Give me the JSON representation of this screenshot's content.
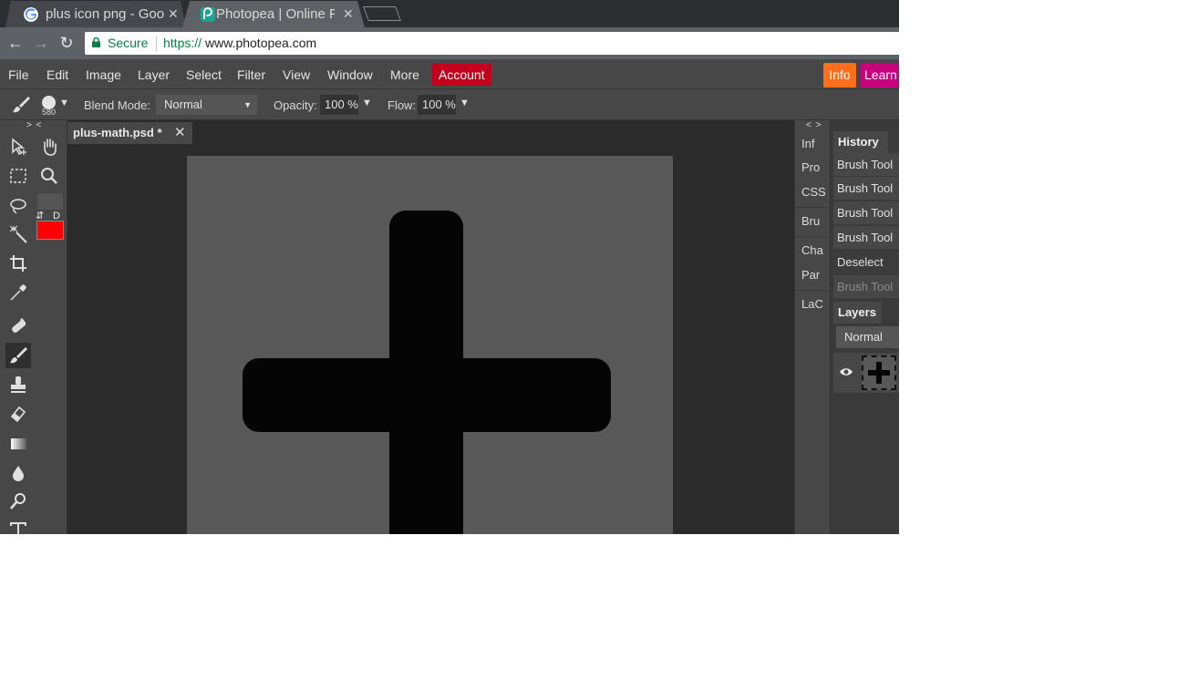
{
  "browser": {
    "tabs": [
      {
        "title": "plus icon png - Goo",
        "favicon": "google-g-icon",
        "active": false
      },
      {
        "title": "Photopea | Online P",
        "favicon": "photopea-icon",
        "active": true
      }
    ],
    "close_glyph": "✕",
    "nav": {
      "back": "←",
      "forward": "→",
      "reload": "↻"
    },
    "address": {
      "secure_label": "Secure",
      "scheme": "https://",
      "host": "www.photopea.com"
    }
  },
  "menubar": {
    "items": [
      "File",
      "Edit",
      "Image",
      "Layer",
      "Select",
      "Filter",
      "View",
      "Window",
      "More"
    ],
    "account": "Account",
    "info": "Info",
    "learn": "Learn"
  },
  "options": {
    "brush_size": "580",
    "blend_label": "Blend Mode:",
    "blend_value": "Normal",
    "opacity_label": "Opacity:",
    "opacity_value": "100 %",
    "flow_label": "Flow:",
    "flow_value": "100 %"
  },
  "toolpanel": {
    "collapse": "> <",
    "swap": "⇵",
    "default": "D",
    "colors": {
      "foreground": "#ff0000",
      "background": "#555555"
    }
  },
  "document": {
    "tab_title": "plus-math.psd *",
    "close": "✕"
  },
  "midpanel": {
    "collapse": "< >",
    "items": [
      "Inf",
      "Pro",
      "CSS",
      "Bru",
      "Cha",
      "Par",
      "LaC"
    ]
  },
  "history": {
    "title": "History",
    "items": [
      "Brush Tool",
      "Brush Tool",
      "Brush Tool",
      "Brush Tool",
      "Deselect",
      "Brush Tool"
    ]
  },
  "layers": {
    "title": "Layers",
    "blend": "Normal"
  }
}
